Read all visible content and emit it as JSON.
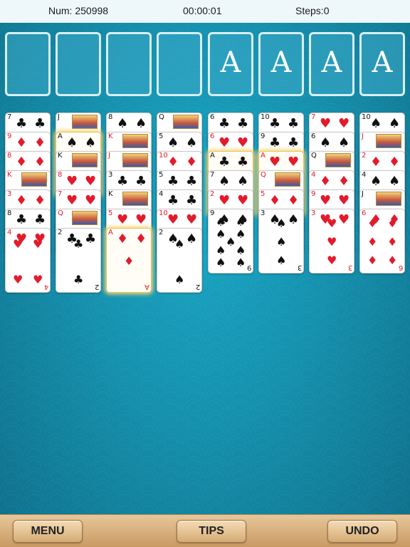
{
  "status": {
    "num": "Num: 250998",
    "timer": "00:00:01",
    "steps": "Steps:0"
  },
  "foundations": [
    "A",
    "A",
    "A",
    "A"
  ],
  "buttons": {
    "menu": "MENU",
    "tips": "TIPS",
    "undo": "UNDO"
  },
  "colors": {
    "background": "#1590ad",
    "slot": "#3caac8",
    "red": "#e21b2b",
    "black": "#111111",
    "highlight": "#f7d774"
  },
  "tableau": [
    [
      {
        "rank": "7",
        "suit": "♣"
      },
      {
        "rank": "9",
        "suit": "♦"
      },
      {
        "rank": "8",
        "suit": "♦"
      },
      {
        "rank": "K",
        "suit": "♦"
      },
      {
        "rank": "3",
        "suit": "♦"
      },
      {
        "rank": "8",
        "suit": "♣"
      },
      {
        "rank": "4",
        "suit": "♥"
      }
    ],
    [
      {
        "rank": "J",
        "suit": "♣"
      },
      {
        "rank": "A",
        "suit": "♠",
        "hl": true
      },
      {
        "rank": "K",
        "suit": "♠"
      },
      {
        "rank": "8",
        "suit": "♥"
      },
      {
        "rank": "7",
        "suit": "♥"
      },
      {
        "rank": "Q",
        "suit": "♦"
      },
      {
        "rank": "2",
        "suit": "♣"
      }
    ],
    [
      {
        "rank": "8",
        "suit": "♠"
      },
      {
        "rank": "K",
        "suit": "♥"
      },
      {
        "rank": "J",
        "suit": "♦"
      },
      {
        "rank": "3",
        "suit": "♣"
      },
      {
        "rank": "K",
        "suit": "♣"
      },
      {
        "rank": "5",
        "suit": "♥"
      },
      {
        "rank": "A",
        "suit": "♦",
        "hl": true
      }
    ],
    [
      {
        "rank": "Q",
        "suit": "♠"
      },
      {
        "rank": "5",
        "suit": "♠"
      },
      {
        "rank": "10",
        "suit": "♦"
      },
      {
        "rank": "5",
        "suit": "♣"
      },
      {
        "rank": "4",
        "suit": "♣"
      },
      {
        "rank": "10",
        "suit": "♥"
      },
      {
        "rank": "2",
        "suit": "♠"
      }
    ],
    [
      {
        "rank": "6",
        "suit": "♣"
      },
      {
        "rank": "6",
        "suit": "♥"
      },
      {
        "rank": "A",
        "suit": "♣",
        "hl": true
      },
      {
        "rank": "7",
        "suit": "♠"
      },
      {
        "rank": "2",
        "suit": "♥"
      },
      {
        "rank": "9",
        "suit": "♠"
      }
    ],
    [
      {
        "rank": "10",
        "suit": "♣"
      },
      {
        "rank": "9",
        "suit": "♣"
      },
      {
        "rank": "A",
        "suit": "♥",
        "hl": true
      },
      {
        "rank": "Q",
        "suit": "♥"
      },
      {
        "rank": "5",
        "suit": "♦"
      },
      {
        "rank": "3",
        "suit": "♠"
      }
    ],
    [
      {
        "rank": "7",
        "suit": "♥"
      },
      {
        "rank": "6",
        "suit": "♠"
      },
      {
        "rank": "Q",
        "suit": "♣"
      },
      {
        "rank": "4",
        "suit": "♦"
      },
      {
        "rank": "9",
        "suit": "♥"
      },
      {
        "rank": "3",
        "suit": "♥"
      }
    ],
    [
      {
        "rank": "10",
        "suit": "♠"
      },
      {
        "rank": "J",
        "suit": "♥"
      },
      {
        "rank": "2",
        "suit": "♦"
      },
      {
        "rank": "4",
        "suit": "♠"
      },
      {
        "rank": "J",
        "suit": "♠"
      },
      {
        "rank": "6",
        "suit": "♦"
      }
    ]
  ]
}
